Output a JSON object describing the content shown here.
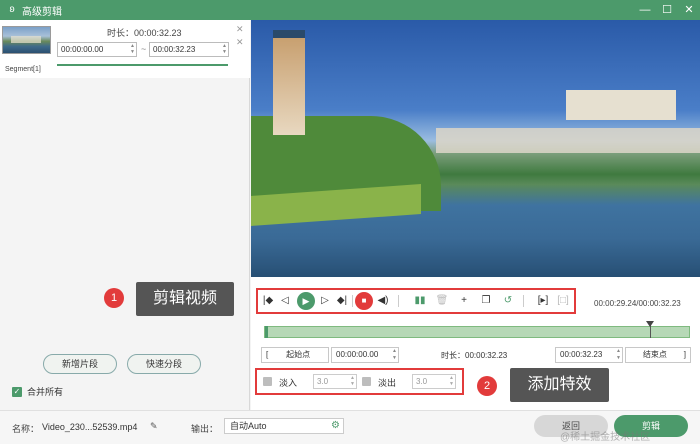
{
  "window": {
    "title": "高级剪辑",
    "minimize_icon": "minimize-icon",
    "maximize_icon": "maximize-icon",
    "close_icon": "close-icon"
  },
  "segment": {
    "duration_label": "时长：00:00:32.23",
    "start": "00:00:00.00",
    "end": "00:00:32.23",
    "separator": "~",
    "label": "Segment[1]"
  },
  "callouts": [
    {
      "number": "1",
      "text": "剪辑视频"
    },
    {
      "number": "2",
      "text": "添加特效"
    }
  ],
  "left_buttons": {
    "new_segment": "新增片段",
    "quick_split": "快速分段"
  },
  "merge": {
    "label": "合并所有",
    "checked": true
  },
  "player": {
    "time_display": "00:00:29.24/00:00:32.23"
  },
  "timeline": {
    "position_fraction": 0.907
  },
  "range": {
    "start_label": "起始点",
    "start": "00:00:00.00",
    "duration_label": "时长：00:00:32.23",
    "end": "00:00:32.23",
    "end_label": "结束点"
  },
  "effects": {
    "fade_in_label": "淡入",
    "fade_in_value": "3.0",
    "fade_out_label": "淡出",
    "fade_out_value": "3.0"
  },
  "bottom": {
    "name_label": "名称：",
    "name_value": "Video_230...52539.mp4",
    "output_label": "输出：",
    "output_value": "自动Auto",
    "back_button": "返回",
    "cut_button": "剪辑"
  },
  "watermark": "@稀土掘金技术社区",
  "colors": {
    "accent": "#4c9a6b",
    "highlight": "#e23b3b"
  }
}
